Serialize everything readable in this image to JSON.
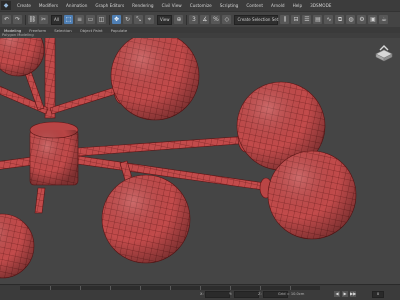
{
  "app": {
    "icon": "3ds-max-logo-icon"
  },
  "menu": {
    "items": [
      "Create",
      "Modifiers",
      "Animation",
      "Graph Editors",
      "Rendering",
      "Civil View",
      "Customize",
      "Scripting",
      "Content",
      "Arnold",
      "Help",
      "3DSMODE"
    ]
  },
  "toolbar": {
    "undo": "↶",
    "redo": "↷",
    "link": "⛓",
    "unlink": "✂",
    "selection_filter": "All",
    "select": "⬚",
    "select_by_name": "≡",
    "rect_region": "▭",
    "window_crossing": "◫",
    "move": "✥",
    "rotate": "↻",
    "scale": "⤡",
    "place": "⌖",
    "ref_coord": "View",
    "pivot": "⊕",
    "snaps": "3",
    "angle_snap": "∡",
    "percent_snap": "%",
    "spinner_snap": "◇",
    "named_selection_placeholder": "Create Selection Set",
    "mirror": "⫼",
    "align": "⊟",
    "layers": "☰",
    "ribbon_toggle": "▤",
    "curve_editor": "∿",
    "schematic": "⧉",
    "material_editor": "◍",
    "render_setup": "⚙",
    "render_frame": "▣",
    "render": "☕"
  },
  "ribbon": {
    "tabs": [
      "Modeling",
      "Freeform",
      "Selection",
      "Object Paint",
      "Populate"
    ]
  },
  "panel_strip": {
    "label": "Polygon Modeling"
  },
  "viewport": {
    "viewcube_icon": "home-view-icon",
    "colors": {
      "background": "#454545",
      "object": "#c24b4b",
      "wire": "#5e1414"
    }
  },
  "statusbar": {
    "x_label": "X:",
    "x_value": "",
    "y_label": "Y:",
    "y_value": "",
    "z_label": "Z:",
    "z_value": "",
    "grid_readout": "Grid = 10.0cm",
    "play_prev": "◀",
    "play": "▶",
    "play_next": "▶▶",
    "frame": "0"
  }
}
